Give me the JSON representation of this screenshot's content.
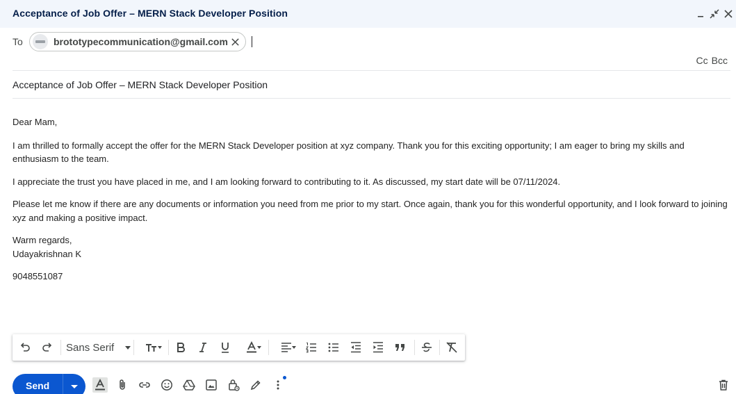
{
  "window": {
    "title": "Acceptance of Job Offer – MERN Stack Developer Position"
  },
  "recipients": {
    "to_label": "To",
    "chips": [
      {
        "email": "brototypecommunication@gmail.com"
      }
    ],
    "cc_label": "Cc",
    "bcc_label": "Bcc"
  },
  "subject": "Acceptance of Job Offer – MERN Stack Developer Position",
  "body": {
    "greeting": "Dear Mam,",
    "para1": "I am thrilled to formally accept the offer for the MERN Stack Developer position at xyz company. Thank you for this exciting opportunity; I am eager to bring my skills and enthusiasm to the team.",
    "para2": "I appreciate the trust you have placed in me, and I am looking forward to contributing to it. As discussed, my start date will be 07/11/2024.",
    "para3": "Please let me know if there are any documents or information you need from me prior to my start. Once again, thank you for this wonderful opportunity, and I look forward to joining xyz and making a positive impact.",
    "closing": "Warm regards,",
    "name": "Udayakrishnan K",
    "phone": "9048551087"
  },
  "format_toolbar": {
    "font_family": "Sans Serif",
    "icons": [
      "undo-icon",
      "redo-icon",
      "text-size-icon",
      "bold-icon",
      "italic-icon",
      "underline-icon",
      "text-color-icon",
      "align-icon",
      "numbered-list-icon",
      "bulleted-list-icon",
      "indent-less-icon",
      "indent-more-icon",
      "quote-icon",
      "strikethrough-icon",
      "remove-formatting-icon"
    ]
  },
  "bottom_bar": {
    "send_label": "Send",
    "icons": [
      "formatting-options-icon",
      "attach-icon",
      "link-icon",
      "emoji-icon",
      "drive-icon",
      "photo-icon",
      "confidential-icon",
      "signature-icon",
      "more-options-icon",
      "delete-icon"
    ]
  },
  "colors": {
    "send_button": "#0b57d0",
    "titlebar_bg": "#f2f6fc",
    "title_text": "#041e49"
  }
}
